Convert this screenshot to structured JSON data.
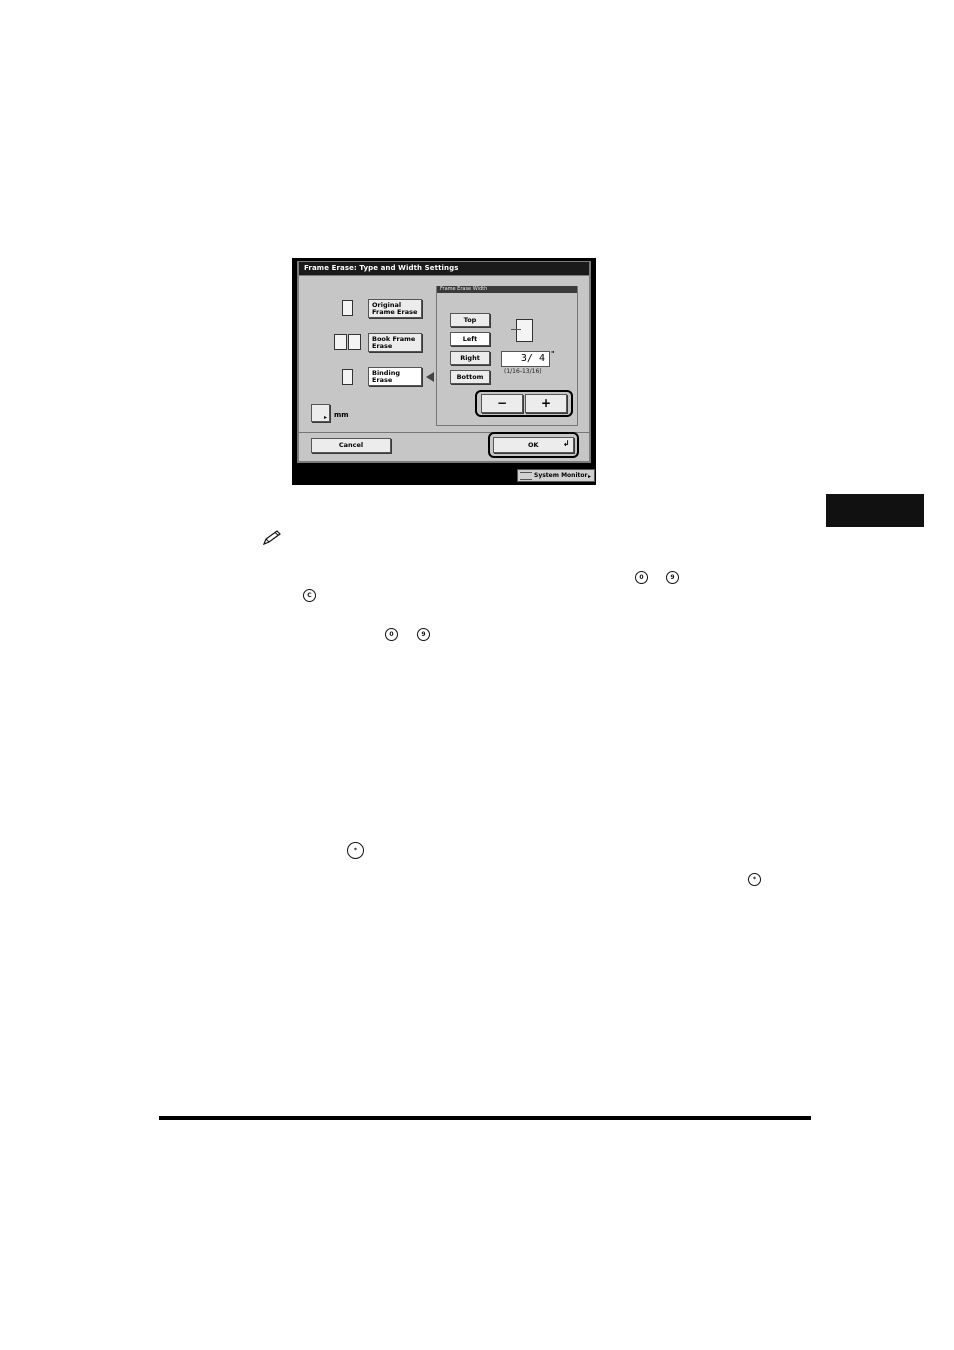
{
  "dialog": {
    "title": "Frame Erase: Type and Width Settings",
    "erase_types": [
      {
        "label_line1": "Original",
        "label_line2": "Frame Erase"
      },
      {
        "label_line1": "Book Frame",
        "label_line2": "Erase"
      },
      {
        "label_line1": "Binding",
        "label_line2": "Erase"
      }
    ],
    "unit_toggle_label": "mm",
    "width_group_title": "Frame Erase Width",
    "sides": [
      "Top",
      "Left",
      "Right",
      "Bottom"
    ],
    "value": "3/ 4",
    "unit": "\"",
    "range": "(1/16-13/16)",
    "minus_label": "−",
    "plus_label": "+",
    "cancel_label": "Cancel",
    "ok_label": "OK",
    "system_monitor_label": "System Monitor"
  },
  "key_icons": {
    "zero": "0",
    "nine": "9",
    "clear": "C",
    "star": "*"
  }
}
